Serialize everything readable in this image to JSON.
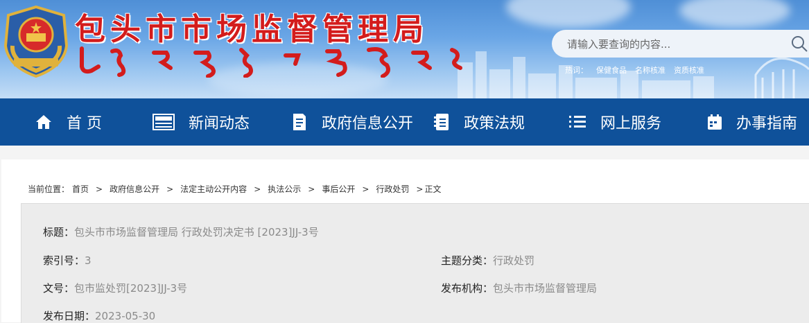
{
  "header": {
    "site_title": "包头市市场监督管理局",
    "emblem_text": "市场监管",
    "search": {
      "placeholder": "请输入要查询的内容..."
    },
    "hot_label": "热词：",
    "hot_words": [
      "保健食品",
      "名称核准",
      "资质核准"
    ]
  },
  "nav": {
    "items": [
      {
        "label": "首 页",
        "icon": "home-icon"
      },
      {
        "label": "新闻动态",
        "icon": "news-icon"
      },
      {
        "label": "政府信息公开",
        "icon": "document-icon"
      },
      {
        "label": "政策法规",
        "icon": "notebook-icon"
      },
      {
        "label": "网上服务",
        "icon": "list-icon"
      },
      {
        "label": "办事指南",
        "icon": "calendar-icon"
      }
    ]
  },
  "breadcrumb": {
    "prefix": "当前位置：",
    "items": [
      "首页",
      "政府信息公开",
      "法定主动公开内容",
      "执法公示",
      "事后公开",
      "行政处罚",
      "正文"
    ],
    "separator": ">"
  },
  "meta": {
    "title_label": "标题：",
    "title_value": "包头市市场监督管理局 行政处罚决定书 [2023]JJ-3号",
    "index_label": "索引号：",
    "index_value": "3",
    "topic_label": "主题分类：",
    "topic_value": "行政处罚",
    "docno_label": "文号：",
    "docno_value": "包市监处罚[2023]JJ-3号",
    "org_label": "发布机构：",
    "org_value": "包头市市场监督管理局",
    "date_label": "发布日期：",
    "date_value": "2023-05-30"
  },
  "colors": {
    "title_red": "#d31c1c",
    "nav_blue": "#0f519a",
    "meta_grey": "#8a8a8a"
  }
}
